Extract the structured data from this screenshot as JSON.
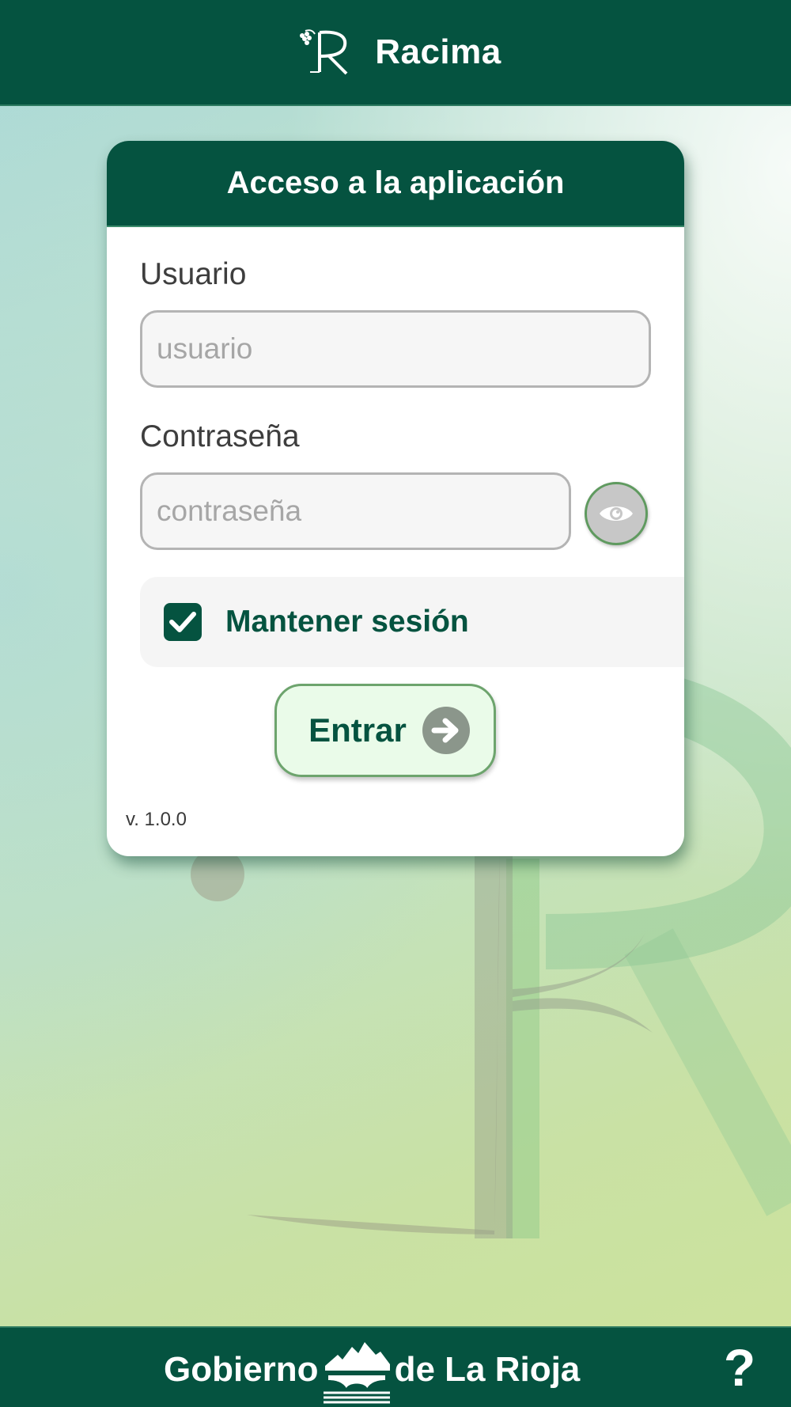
{
  "header": {
    "title": "Racima",
    "logo_icon": "racima-r-grape-logo"
  },
  "login": {
    "title": "Acceso a la aplicación",
    "username_label": "Usuario",
    "username_value": "",
    "username_placeholder": "usuario",
    "password_label": "Contraseña",
    "password_value": "",
    "password_placeholder": "contraseña",
    "show_password_icon": "eye-icon",
    "keep_session_label": "Mantener sesión",
    "keep_session_checked": true,
    "submit_label": "Entrar",
    "submit_icon": "arrow-right-circle-icon",
    "version": "v. 1.0.0"
  },
  "footer": {
    "gov_left": "Gobierno",
    "gov_right": "de La Rioja",
    "emblem_icon": "la-rioja-emblem",
    "help_label": "?"
  },
  "colors": {
    "primary": "#055340",
    "accent_border": "#6da46d",
    "button_bg": "#eafbe9"
  }
}
